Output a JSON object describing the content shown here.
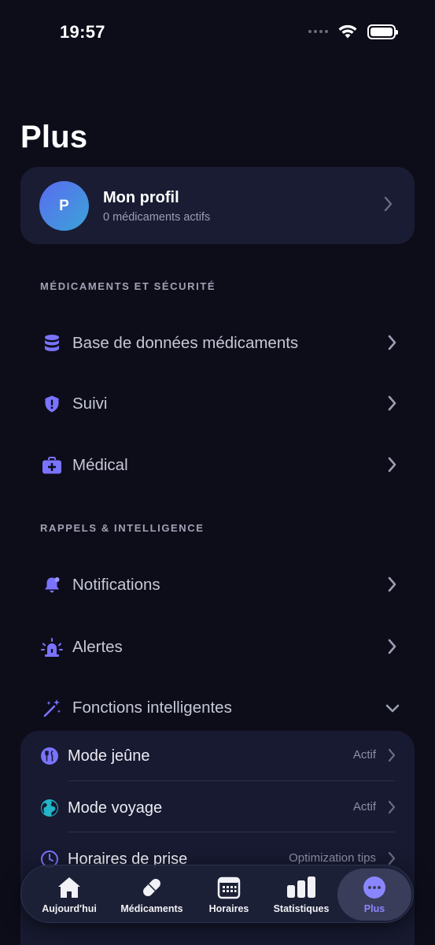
{
  "status_bar": {
    "time": "19:57"
  },
  "page": {
    "title": "Plus"
  },
  "profile": {
    "initial": "P",
    "name": "Mon profil",
    "subtitle": "0 médicaments actifs"
  },
  "sections": {
    "medications": {
      "header": "MÉDICAMENTS ET SÉCURITÉ",
      "items": [
        {
          "label": "Base de données médicaments",
          "icon": "database-icon"
        },
        {
          "label": "Suivi",
          "icon": "shield-alert-icon"
        },
        {
          "label": "Médical",
          "icon": "medkit-icon"
        }
      ]
    },
    "reminders": {
      "header": "RAPPELS & INTELLIGENCE",
      "items": [
        {
          "label": "Notifications",
          "icon": "bell-icon"
        },
        {
          "label": "Alertes",
          "icon": "siren-icon"
        },
        {
          "label": "Fonctions intelligentes",
          "icon": "sparkles-icon",
          "expanded": true
        }
      ]
    }
  },
  "smart_features": [
    {
      "label": "Mode jeûne",
      "status": "Actif",
      "icon": "fasting-icon"
    },
    {
      "label": "Mode voyage",
      "status": "Actif",
      "icon": "globe-icon"
    },
    {
      "label": "Horaires de prise",
      "status": "Optimization tips",
      "icon": "clock-icon"
    }
  ],
  "tab_bar": {
    "tabs": [
      {
        "label": "Aujourd'hui",
        "icon": "home-icon"
      },
      {
        "label": "Médicaments",
        "icon": "pill-icon"
      },
      {
        "label": "Horaires",
        "icon": "calendar-icon"
      },
      {
        "label": "Statistiques",
        "icon": "bar-chart-icon"
      },
      {
        "label": "Plus",
        "icon": "more-icon",
        "active": true
      }
    ]
  },
  "colors": {
    "background": "#0d0d1a",
    "accent": "#6c63ff",
    "teal": "#22b5c9"
  }
}
